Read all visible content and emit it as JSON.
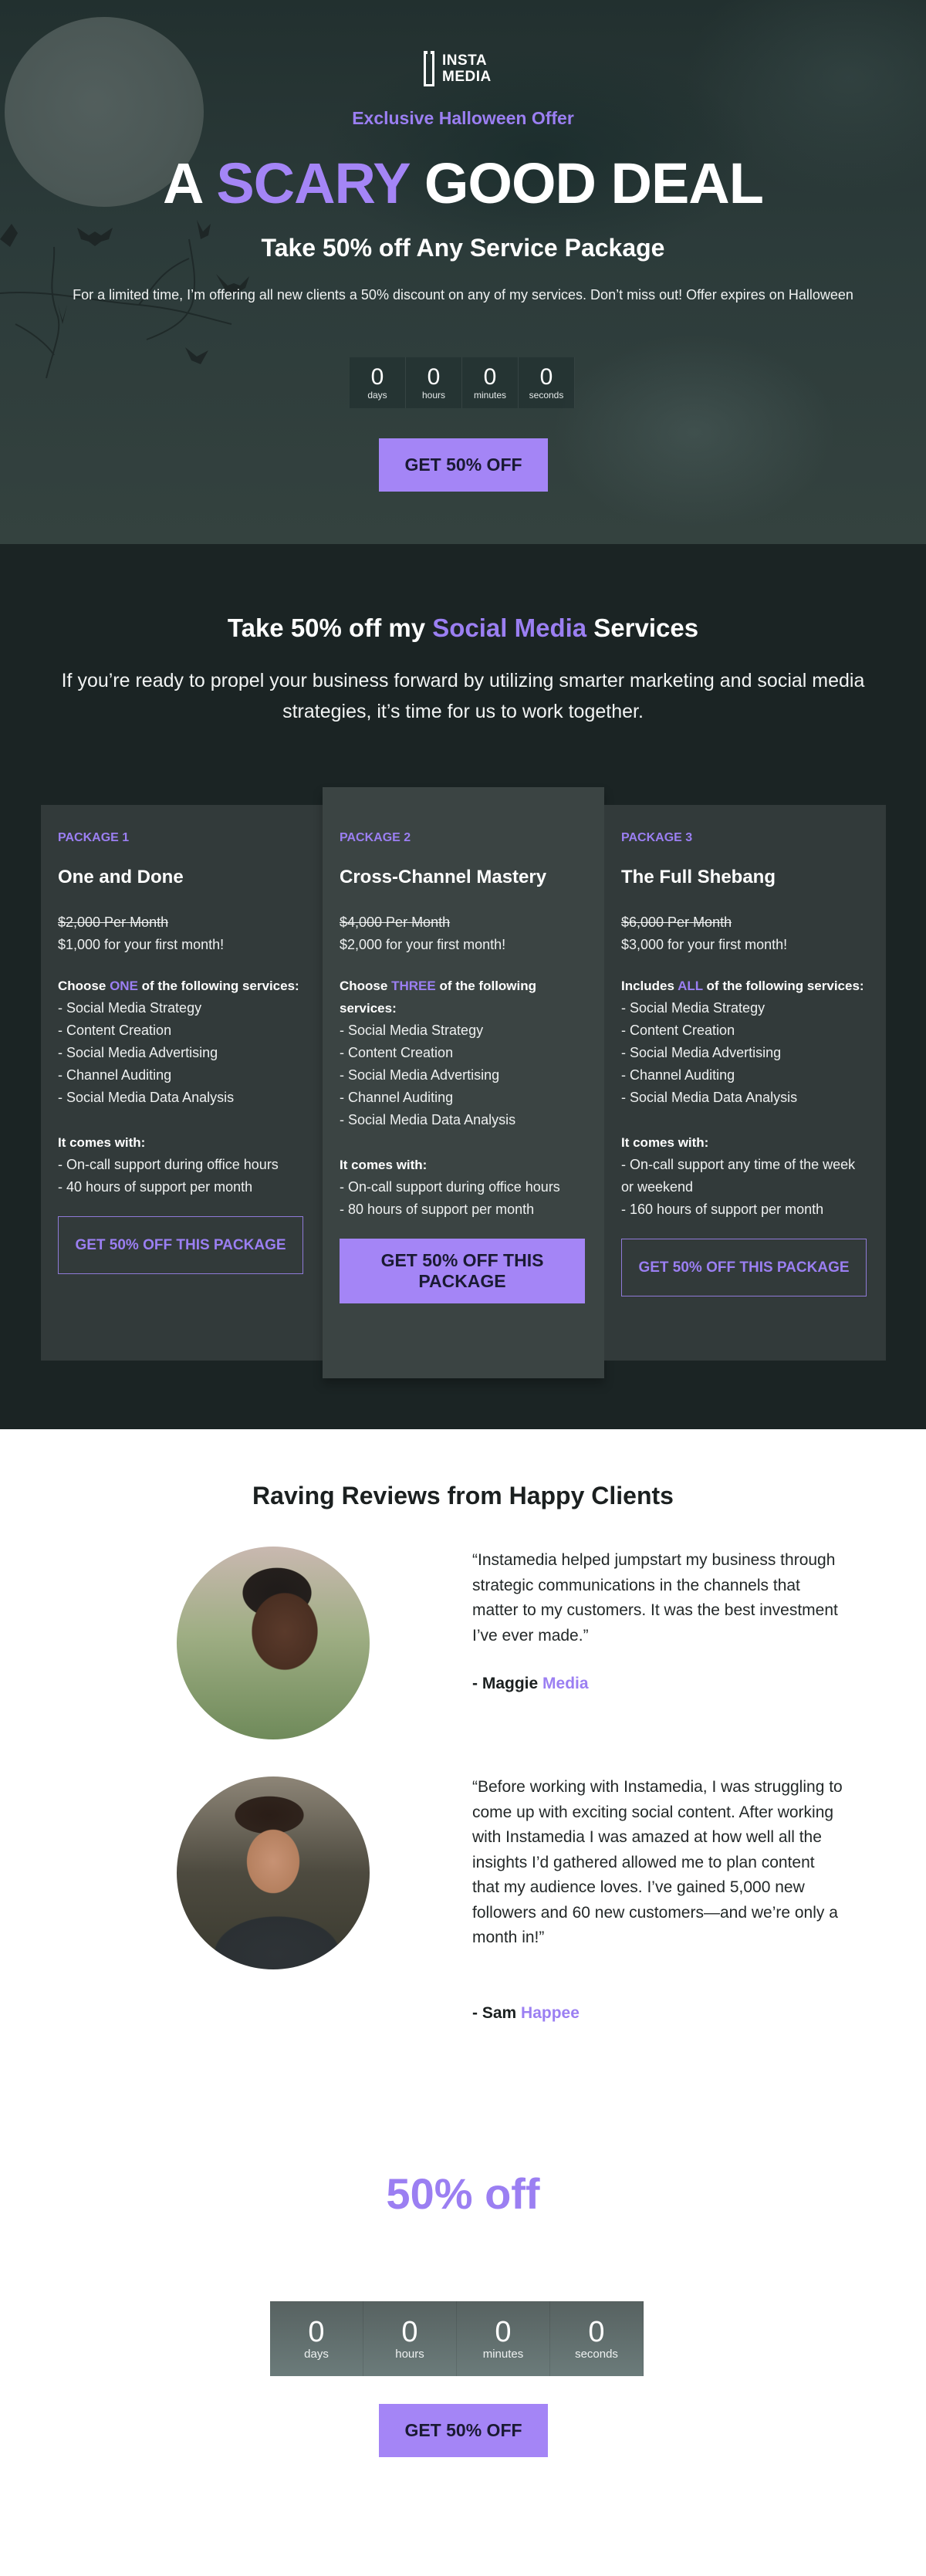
{
  "hero": {
    "logo": {
      "line1": "INSTA",
      "line2": "MEDIA"
    },
    "eyebrow": "Exclusive Halloween Offer",
    "headline": {
      "prefix": "A",
      "accent": "SCARY",
      "suffix": "GOOD DEAL"
    },
    "subhead": "Take 50% off Any Service Package",
    "description": "For a limited time, I’m offering all new clients a 50% discount on any of my services. Don’t miss out! Offer expires on Halloween",
    "countdown": [
      {
        "value": "0",
        "label": "days"
      },
      {
        "value": "0",
        "label": "hours"
      },
      {
        "value": "0",
        "label": "minutes"
      },
      {
        "value": "0",
        "label": "seconds"
      }
    ],
    "cta_label": "GET 50% OFF"
  },
  "services": {
    "title": {
      "prefix": "Take 50% off my",
      "accent": "Social Media",
      "suffix": "Services"
    },
    "description": "If you’re ready to propel your business forward by utilizing smarter marketing and social media strategies, it’s time for us to work together.",
    "packages": [
      {
        "label": "PACKAGE 1",
        "name": "One and Done",
        "old_price": "$2,000 Per Month",
        "new_price": "$1,000 for your first month!",
        "choose_prefix": "Choose",
        "choose_accent": "ONE",
        "choose_suffix": "of the following services:",
        "services": [
          "- Social Media Strategy",
          "- Content Creation",
          "- Social Media Advertising",
          "- Channel Auditing",
          "- Social Media Data Analysis"
        ],
        "comes_with_title": "It comes with:",
        "comes_with": [
          "- On-call support during office hours",
          "- 40 hours of support per month"
        ],
        "cta_label": "GET 50% OFF THIS PACKAGE"
      },
      {
        "label": "PACKAGE 2",
        "name": "Cross-Channel Mastery",
        "old_price": "$4,000 Per Month",
        "new_price": "$2,000 for your first month!",
        "choose_prefix": "Choose",
        "choose_accent": "THREE",
        "choose_suffix": "of the following services:",
        "services": [
          "- Social Media Strategy",
          "- Content Creation",
          "- Social Media Advertising",
          "- Channel Auditing",
          "- Social Media Data Analysis"
        ],
        "comes_with_title": "It comes with:",
        "comes_with": [
          "- On-call support during office hours",
          "- 80 hours of support per month"
        ],
        "cta_label": "GET 50% OFF THIS PACKAGE"
      },
      {
        "label": "PACKAGE 3",
        "name": "The Full Shebang",
        "old_price": "$6,000 Per Month",
        "new_price": "$3,000 for your first month!",
        "choose_prefix": "Includes",
        "choose_accent": "ALL",
        "choose_suffix": "of the following services:",
        "services": [
          "- Social Media Strategy",
          "- Content Creation",
          "- Social Media Advertising",
          "- Channel Auditing",
          "- Social Media Data Analysis"
        ],
        "comes_with_title": "It comes with:",
        "comes_with": [
          "- On-call support any time of the week or weekend",
          "- 160 hours of support per month"
        ],
        "cta_label": "GET 50% OFF THIS PACKAGE"
      }
    ]
  },
  "reviews": {
    "title": "Raving Reviews from Happy Clients",
    "items": [
      {
        "quote": "“Instamedia helped jumpstart my business through strategic communications in the channels that matter to my customers. It was the best investment I’ve ever made.”",
        "author_prefix": "- Maggie",
        "author_accent": "Media"
      },
      {
        "quote": "“Before working with Instamedia, I was struggling to come up with exciting social content. After working with Instamedia I was amazed at how well all the insights I’d gathered allowed me to plan content that my audience loves. I’ve gained 5,000 new followers and 60 new customers—and we’re only a month in!”",
        "author_prefix": "- Sam",
        "author_accent": "Happee"
      }
    ]
  },
  "final": {
    "headline": "50% off",
    "countdown": [
      {
        "value": "0",
        "label": "days"
      },
      {
        "value": "0",
        "label": "hours"
      },
      {
        "value": "0",
        "label": "minutes"
      },
      {
        "value": "0",
        "label": "seconds"
      }
    ],
    "cta_label": "GET 50% OFF"
  },
  "colors": {
    "accent": "#a485f6",
    "accent_text": "#9b7ff2",
    "dark_bg": "#1b2424",
    "card_bg": "#323a3a",
    "featured_card_bg": "#3b4443"
  }
}
